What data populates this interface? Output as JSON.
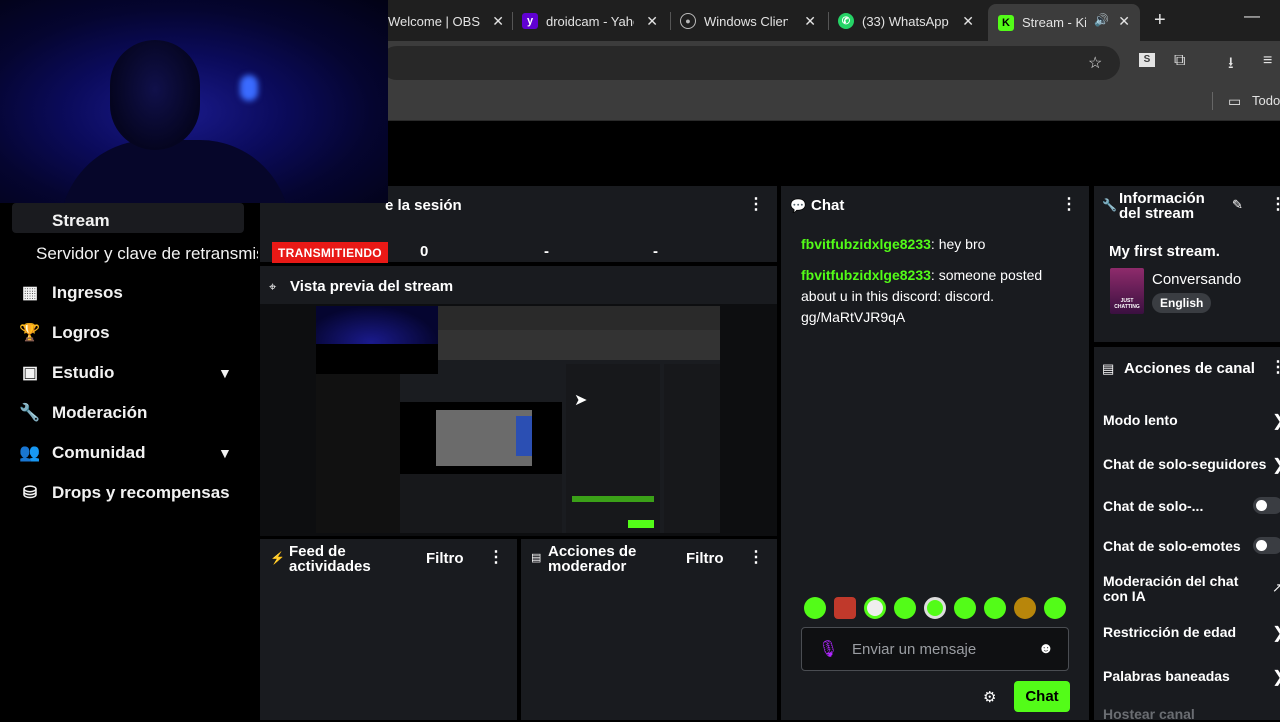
{
  "browser": {
    "tabs": [
      {
        "title": "Welcome | OBS",
        "active": false
      },
      {
        "title": "droidcam - Yaho",
        "active": false
      },
      {
        "title": "Windows Client",
        "active": false
      },
      {
        "title": "(33) WhatsApp",
        "active": false
      },
      {
        "title": "Stream - Kick",
        "active": true
      }
    ],
    "bookmark_folder": "Todo"
  },
  "sidebar": {
    "stream_label": "Stream",
    "items": [
      {
        "label": "Servidor y clave de retransmisión"
      },
      {
        "label": "Ingresos"
      },
      {
        "label": "Logros"
      },
      {
        "label": "Estudio"
      },
      {
        "label": "Moderación"
      },
      {
        "label": "Comunidad"
      },
      {
        "label": "Drops y recompensas"
      }
    ]
  },
  "session": {
    "title_fragment": "e la sesión",
    "status_badge": "TRANSMITIENDO",
    "viewers": "0",
    "stat2": "-",
    "stat3": "-"
  },
  "preview": {
    "title": "Vista previa del stream"
  },
  "activity_feed": {
    "title": "Feed de actividades",
    "filter": "Filtro"
  },
  "mod_actions": {
    "title": "Acciones de moderador",
    "filter": "Filtro"
  },
  "chat": {
    "title": "Chat",
    "messages": [
      {
        "user": "fbvitfubzidxlge8233",
        "text": ": hey bro"
      },
      {
        "user": "fbvitfubzidxlge8233",
        "text": ": someone posted about u in this discord: discord. gg/MaRtVJR9qA"
      }
    ],
    "input_placeholder": "Enviar un mensaje",
    "send_label": "Chat"
  },
  "stream_info": {
    "title": "Información del stream",
    "stream_title": "My first stream.",
    "category": "Conversando",
    "language": "English",
    "thumb_text": "JUST CHATTING"
  },
  "channel_actions": {
    "title": "Acciones de canal",
    "items": [
      {
        "label": "Modo lento",
        "control": "chevron"
      },
      {
        "label": "Chat de solo-seguidores",
        "control": "chevron"
      },
      {
        "label": "Chat de solo-...",
        "control": "toggle"
      },
      {
        "label": "Chat de solo-emotes",
        "control": "toggle"
      },
      {
        "label": "Moderación del chat con IA",
        "control": "external"
      },
      {
        "label": "Restricción de edad",
        "control": "chevron"
      },
      {
        "label": "Palabras baneadas",
        "control": "chevron"
      },
      {
        "label": "Hostear canal",
        "control": "none"
      }
    ]
  },
  "colors": {
    "accent": "#53fc18",
    "live_badge": "#e91916",
    "panel": "#191b1f"
  }
}
